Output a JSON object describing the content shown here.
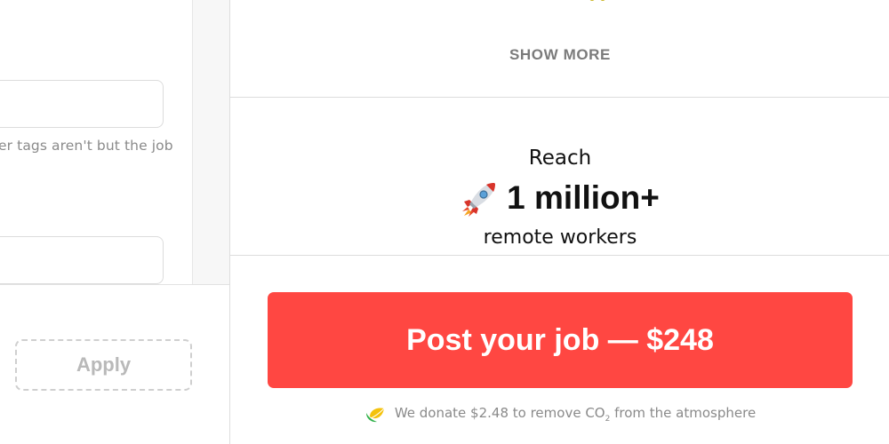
{
  "left_form": {
    "field_1_value": "",
    "hint_text": "er tags aren't but the job",
    "field_2_value": "",
    "apply_label": "Apply"
  },
  "right_column": {
    "show_more_label": "SHOW MORE",
    "reach": {
      "prefix": "Reach",
      "headline": "1 million+",
      "suffix": "remote workers",
      "icon": "rocket-icon"
    },
    "post_button_label": "Post your job — $248",
    "donate": {
      "icon": "leaf-icon",
      "text_before": "We donate $2.48 to remove CO",
      "subscript": "2",
      "text_after": " from the atmosphere"
    }
  },
  "colors": {
    "primary_button": "#ff4742",
    "muted_text": "#8a8a8a",
    "border": "#dcdcdc"
  }
}
